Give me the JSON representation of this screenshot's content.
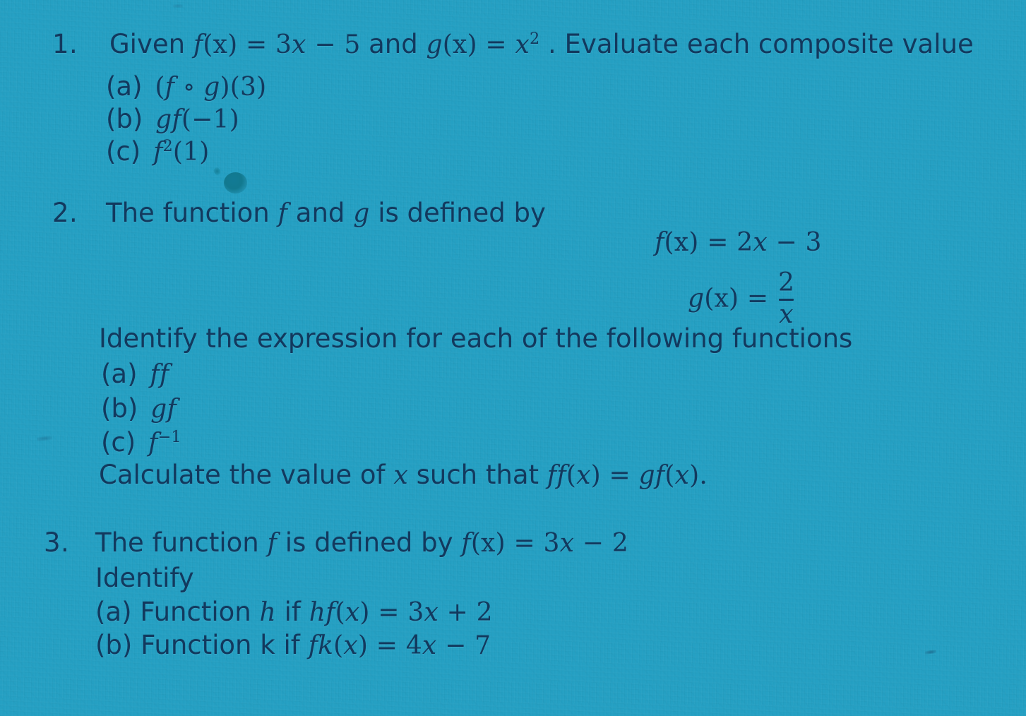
{
  "document": {
    "kind": "handout-worksheet-photo",
    "subject": "Composite and inverse functions exercise",
    "paper_color": "#25a0c3",
    "ink_color": "#12395e",
    "marks": [
      {
        "name": "ink-blot",
        "note": "dark teal ink blot between question 1 and 2"
      },
      {
        "name": "edge-smudge-left",
        "note": "faint smudge at left margin near (c) of Q2"
      },
      {
        "name": "edge-smudge-right",
        "note": "small dark fleck near bottom right"
      }
    ]
  },
  "questions": [
    {
      "number": "1.",
      "stem_pre": "Given",
      "stem_fn1_f": "f",
      "stem_fn1_args": "(x)",
      "stem_fn1_eq": "=",
      "stem_fn1_rhs_coef": "3",
      "stem_fn1_rhs_var": "x",
      "stem_fn1_rhs_op": "−",
      "stem_fn1_rhs_const": "5",
      "stem_mid": "and",
      "stem_fn2_g": "g",
      "stem_fn2_args": "(x)",
      "stem_fn2_eq": "=",
      "stem_fn2_rhs_var": "x",
      "stem_fn2_rhs_exp": "2",
      "stem_post": ". Evaluate each composite value",
      "parts": [
        {
          "label": "(a)",
          "math_plain": "(f ∘ g)(3)"
        },
        {
          "label": "(b)",
          "math_plain": "gf(−1)"
        },
        {
          "label": "(c)",
          "math_plain": "f²(1)"
        }
      ]
    },
    {
      "number": "2.",
      "stem": "The function f and g is defined by",
      "stem_words_pre": "The function",
      "stem_var_f": "f",
      "stem_words_mid": "and",
      "stem_var_g": "g",
      "stem_words_post": "is defined by",
      "definitions": [
        {
          "lhs_fn": "f",
          "lhs_args": "(x)",
          "eq": "=",
          "rhs": "2x − 3",
          "rhs_coef": "2",
          "rhs_var": "x",
          "rhs_op": "−",
          "rhs_const": "3"
        },
        {
          "lhs_fn": "g",
          "lhs_args": "(x)",
          "eq": "=",
          "rhs": "2/x",
          "numerator": "2",
          "denominator": "x"
        }
      ],
      "instruction": "Identify the expression for each of the following functions",
      "parts": [
        {
          "label": "(a)",
          "math_plain": "ff"
        },
        {
          "label": "(b)",
          "math_plain": "gf"
        },
        {
          "label": "(c)",
          "math_plain": "f⁻¹"
        }
      ],
      "final_task_pre": "Calculate the value of",
      "final_task_var": "x",
      "final_task_mid": "such that",
      "final_task_eq_lhs": "ff(x)",
      "final_task_eq_sign": "=",
      "final_task_eq_rhs": "gf(x).",
      "final_task_plain": "Calculate the value of x such that ff(x) = gf(x)."
    },
    {
      "number": "3.",
      "stem_pre": "The function",
      "stem_var": "f",
      "stem_mid": "is defined by",
      "stem_eq_lhs_fn": "f",
      "stem_eq_lhs_args": "(x)",
      "stem_eq_sign": "=",
      "stem_eq_coef": "3",
      "stem_eq_var": "x",
      "stem_eq_op": "−",
      "stem_eq_const": "2",
      "instruction": "Identify",
      "parts": [
        {
          "label": "(a)",
          "text_pre": "Function",
          "fn": "h",
          "text_mid": "if",
          "eq_lhs": "hf(x)",
          "eq_sign": "=",
          "eq_rhs_coef": "3",
          "eq_rhs_var": "x",
          "eq_rhs_op": "+",
          "eq_rhs_const": "2",
          "plain": "Function h if hf(x) = 3x + 2"
        },
        {
          "label": "(b)",
          "text_pre": "Function",
          "fn": "k",
          "text_mid": "if",
          "eq_lhs": "fk(x)",
          "eq_sign": "=",
          "eq_rhs_coef": "4",
          "eq_rhs_var": "x",
          "eq_rhs_op": "−",
          "eq_rhs_const": "7",
          "plain": "Function k if fk(x) = 4x − 7"
        }
      ]
    }
  ]
}
